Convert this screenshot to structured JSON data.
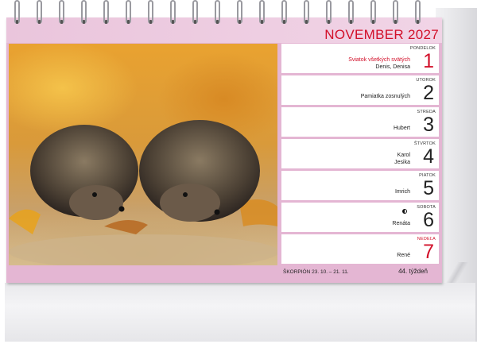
{
  "calendar": {
    "month_title": "NOVEMBER 2027",
    "footer": {
      "zodiac": "ŠKORPIÓN  23. 10. – 21. 11.",
      "week": "44. týždeň"
    },
    "days": [
      {
        "name": "PONDELOK",
        "number": "1",
        "lines": [
          "Sviatok všetkých svätých",
          "Denis, Denisa"
        ],
        "holiday": true
      },
      {
        "name": "UTOROK",
        "number": "2",
        "lines": [
          "Pamiatka zosnulých"
        ]
      },
      {
        "name": "STREDA",
        "number": "3",
        "lines": [
          "Hubert"
        ]
      },
      {
        "name": "ŠTVRTOK",
        "number": "4",
        "lines": [
          "Karol",
          "Jesika"
        ]
      },
      {
        "name": "PIATOK",
        "number": "5",
        "lines": [
          "Imrich"
        ]
      },
      {
        "name": "SOBOTA",
        "number": "6",
        "lines": [
          "Renáta"
        ],
        "moon_icon": "half-moon-icon"
      },
      {
        "name": "NEDEĽA",
        "number": "7",
        "lines": [
          "René"
        ],
        "sunday": true
      }
    ]
  },
  "photo": {
    "subject_icon": "hedgehogs-photo"
  },
  "colors": {
    "accent_red": "#d2102a",
    "band_pink": "#e4b6d3"
  }
}
